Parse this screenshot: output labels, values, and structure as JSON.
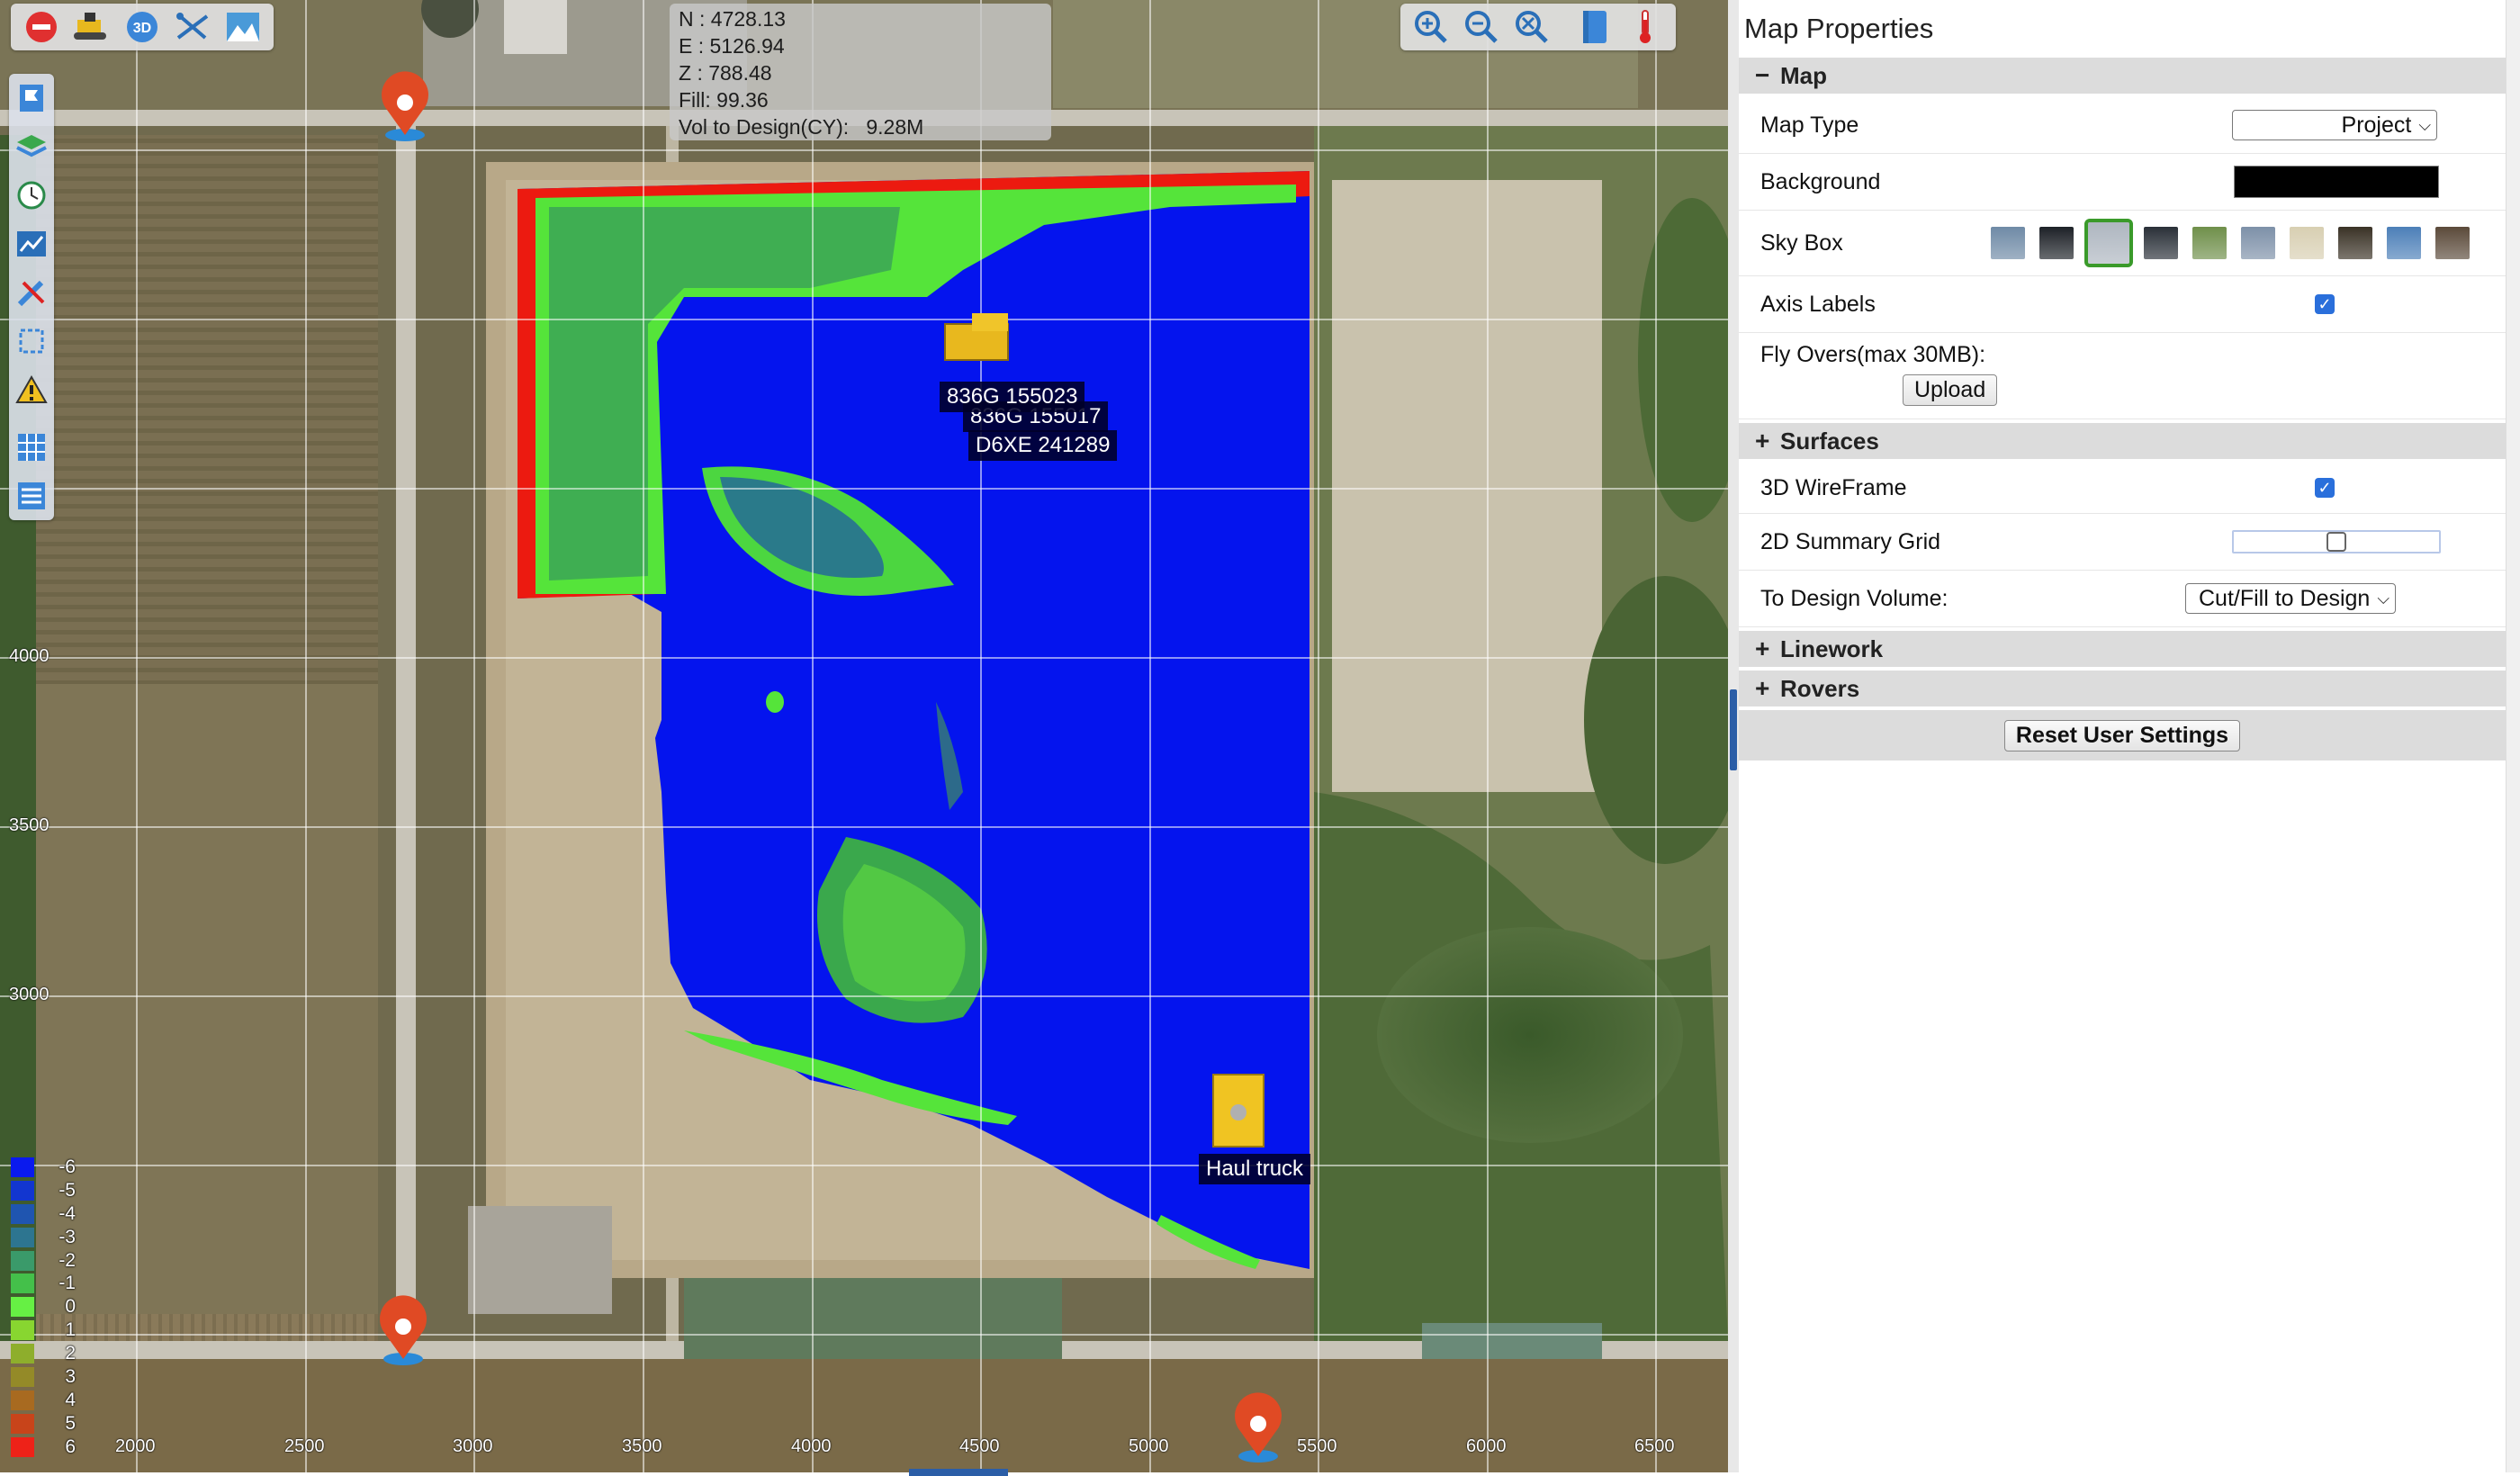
{
  "toolbar_left": [
    {
      "name": "exit-icon",
      "color": "#e03030"
    },
    {
      "name": "machine-icon"
    },
    {
      "name": "3d-view-icon",
      "label": "3D"
    },
    {
      "name": "measure-tool-icon"
    },
    {
      "name": "terrain-icon"
    }
  ],
  "toolbar_right": [
    {
      "name": "zoom-in-icon"
    },
    {
      "name": "zoom-out-icon"
    },
    {
      "name": "zoom-extents-icon"
    },
    {
      "name": "book-icon"
    },
    {
      "name": "thermometer-icon"
    }
  ],
  "side_toolbar": [
    {
      "name": "flag-icon"
    },
    {
      "name": "layers-icon"
    },
    {
      "name": "clock-icon"
    },
    {
      "name": "chart-icon"
    },
    {
      "name": "tools-icon"
    },
    {
      "name": "selection-icon"
    },
    {
      "name": "warning-icon"
    },
    {
      "name": "grid-icon"
    },
    {
      "name": "list-icon"
    }
  ],
  "readout": {
    "n": "N : 4728.13",
    "e": "E : 5126.94",
    "z": "Z : 788.48",
    "fill": "Fill: 99.36",
    "vol": "Vol to Design(CY):   9.28M"
  },
  "axis": {
    "x_ticks": [
      "2000",
      "2500",
      "3000",
      "3500",
      "4000",
      "4500",
      "5000",
      "5500",
      "6000",
      "6500"
    ],
    "y_ticks": [
      "4000",
      "3500",
      "3000"
    ]
  },
  "machines": {
    "m1": "836G 155023",
    "m2": "836G 155017",
    "m3": "D6XE 241289",
    "truck": "Haul truck"
  },
  "legend": [
    {
      "value": "-6",
      "color": "#0a1aee"
    },
    {
      "value": "-5",
      "color": "#1236d0"
    },
    {
      "value": "-4",
      "color": "#1f55b0"
    },
    {
      "value": "-3",
      "color": "#2d7590"
    },
    {
      "value": "-2",
      "color": "#3a9a6a"
    },
    {
      "value": "-1",
      "color": "#44c04a"
    },
    {
      "value": "0",
      "color": "#66f044"
    },
    {
      "value": "1",
      "color": "#88d630"
    },
    {
      "value": "2",
      "color": "#8eae2c"
    },
    {
      "value": "3",
      "color": "#948a28"
    },
    {
      "value": "4",
      "color": "#a86a20"
    },
    {
      "value": "5",
      "color": "#c8441a"
    },
    {
      "value": "6",
      "color": "#ee2218"
    }
  ],
  "panel": {
    "title": "Map Properties",
    "sections": {
      "map": {
        "toggle": "−",
        "label": "Map"
      },
      "surfaces": {
        "toggle": "+",
        "label": "Surfaces"
      },
      "linework": {
        "toggle": "+",
        "label": "Linework"
      },
      "rovers": {
        "toggle": "+",
        "label": "Rovers"
      }
    },
    "map_type": {
      "label": "Map Type",
      "value": "Project"
    },
    "background": {
      "label": "Background",
      "color": "#000000"
    },
    "sky_box": {
      "label": "Sky Box",
      "options": [
        "#6f8aa6",
        "#1d2127",
        "#aeb6c0",
        "#2a3038",
        "#6f8f4a",
        "#7d90a8",
        "#d8cfb2",
        "#3a3226",
        "#4c7fb8",
        "#5b4a3a"
      ],
      "selected": 2
    },
    "axis_labels": {
      "label": "Axis Labels",
      "checked": true
    },
    "fly_overs": {
      "label": "Fly Overs(max 30MB):",
      "button": "Upload"
    },
    "wireframe": {
      "label": "3D WireFrame",
      "checked": true
    },
    "summary_grid": {
      "label": "2D Summary Grid",
      "checked": false
    },
    "design_volume": {
      "label": "To Design Volume:",
      "value": "Cut/Fill to Design"
    },
    "reset": "Reset User Settings"
  }
}
